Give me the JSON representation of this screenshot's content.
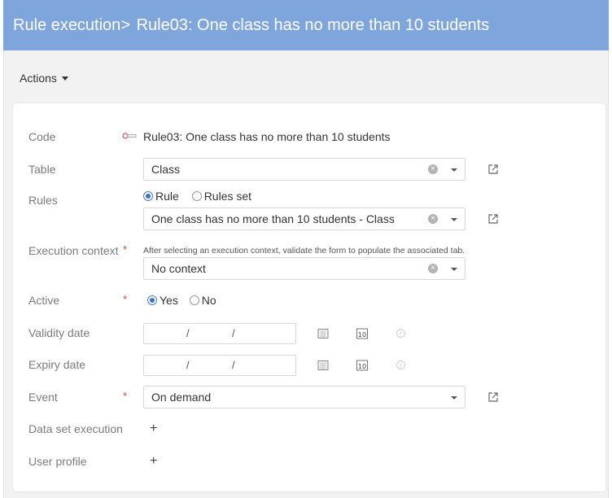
{
  "header": {
    "breadcrumb": "Rule execution",
    "separator": ">",
    "title": "Rule03: One class has no more than 10 students"
  },
  "toolbar": {
    "actions_label": "Actions"
  },
  "form": {
    "code": {
      "label": "Code",
      "value": "Rule03: One class has no more than 10 students",
      "icon": "key-icon"
    },
    "table": {
      "label": "Table",
      "value": "Class"
    },
    "rules": {
      "label": "Rules",
      "option_rule": "Rule",
      "option_rules_set": "Rules set",
      "selected": "Rule",
      "value": "One class has no more than 10 students - Class"
    },
    "execution_context": {
      "label": "Execution context",
      "required_mark": "*",
      "hint": "After selecting an execution context, validate the form to populate the associated tab.",
      "value": "No context"
    },
    "active": {
      "label": "Active",
      "required_mark": "*",
      "option_yes": "Yes",
      "option_no": "No",
      "selected": "Yes"
    },
    "validity_date": {
      "label": "Validity date",
      "sep": "/"
    },
    "expiry_date": {
      "label": "Expiry date",
      "sep": "/"
    },
    "event": {
      "label": "Event",
      "required_mark": "*",
      "value": "On demand"
    },
    "data_set_execution": {
      "label": "Data set execution",
      "add": "+"
    },
    "user_profile": {
      "label": "User profile",
      "add": "+"
    }
  },
  "colors": {
    "header_bg": "#7ea6dc",
    "required": "#e0463c",
    "radio_accent": "#3b73c2"
  }
}
